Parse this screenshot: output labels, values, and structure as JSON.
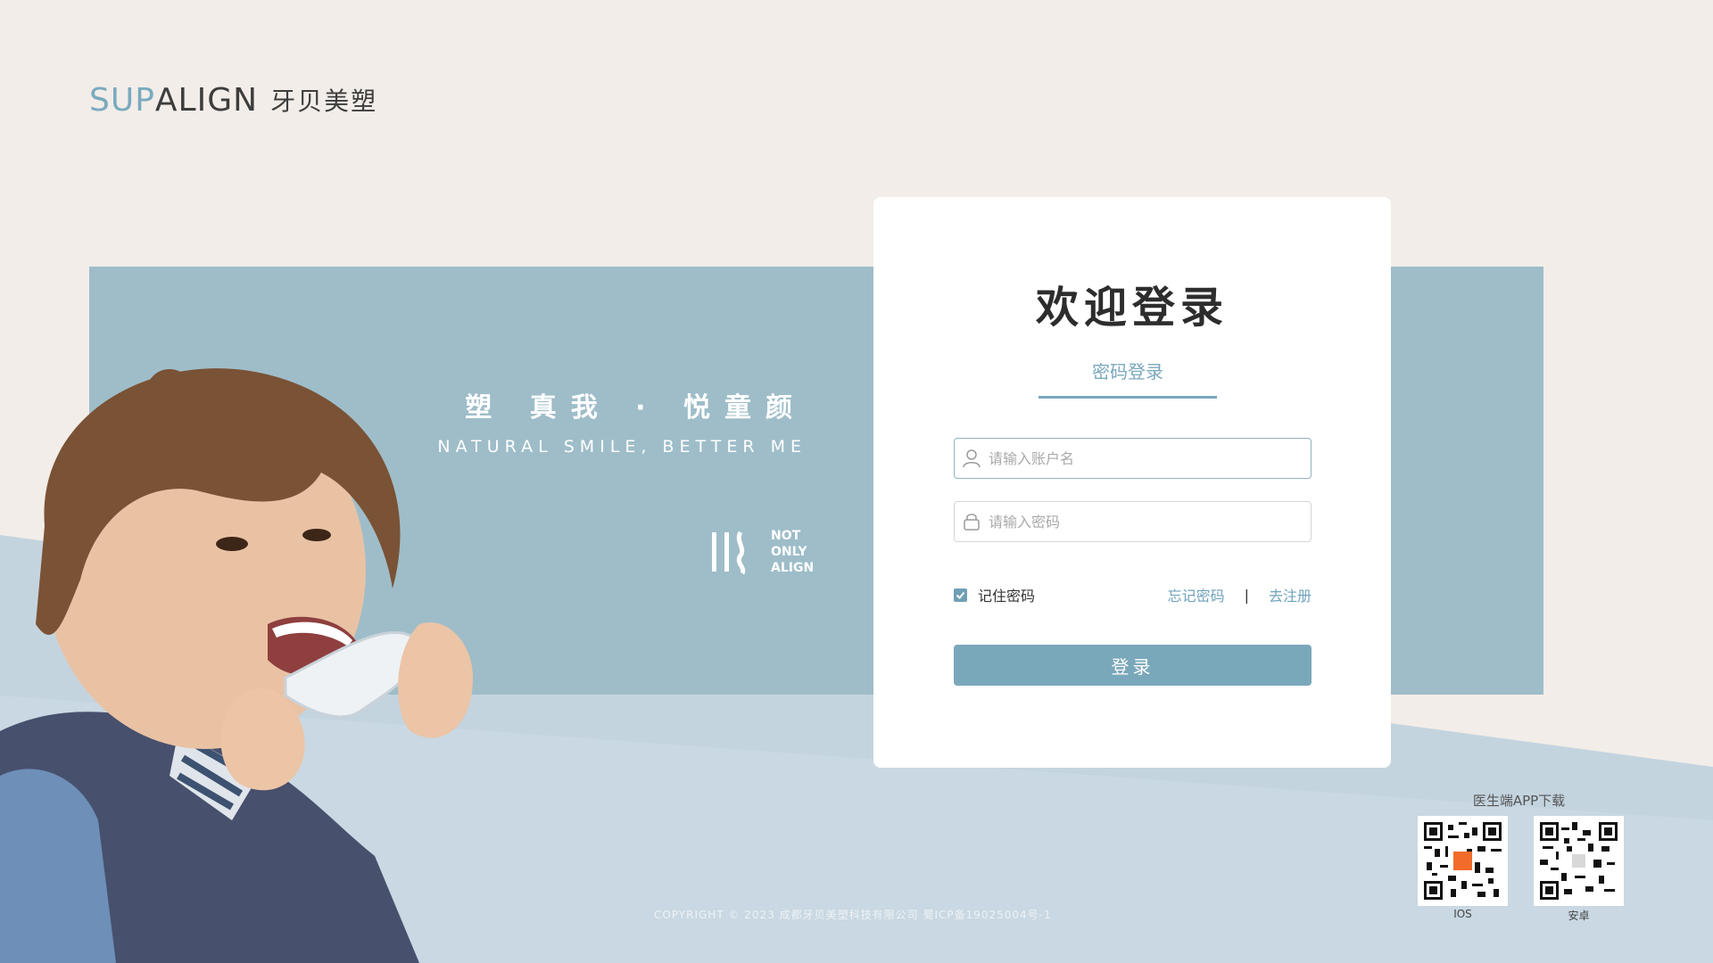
{
  "brand": {
    "logo_part1": "SUP",
    "logo_part2": "ALIGN",
    "logo_cn": "牙贝美塑",
    "slogan_cn": "塑 真我 · 悦童颜",
    "slogan_en": "NATURAL SMILE, BETTER ME",
    "mark_lines": [
      "NOT",
      "ONLY",
      "ALIGN"
    ]
  },
  "login": {
    "title": "欢迎登录",
    "tab_label": "密码登录",
    "username_placeholder": "请输入账户名",
    "password_placeholder": "请输入密码",
    "remember_label": "记住密码",
    "remember_checked": true,
    "forgot_label": "忘记密码",
    "separator": "|",
    "register_label": "去注册",
    "submit_label": "登录"
  },
  "download": {
    "title": "医生端APP下载",
    "ios_label": "IOS",
    "android_label": "安卓"
  },
  "footer": {
    "copyright": "COPYRIGHT ©  2023 成都牙贝美塑科技有限公司 蜀ICP备19025004号-1"
  },
  "colors": {
    "page_bg": "#f2ede8",
    "band_blue": "#9ebdc9",
    "accent": "#7aa8bb"
  },
  "icons": {
    "username": "user-icon",
    "password": "lock-icon",
    "checkbox": "check-icon"
  }
}
